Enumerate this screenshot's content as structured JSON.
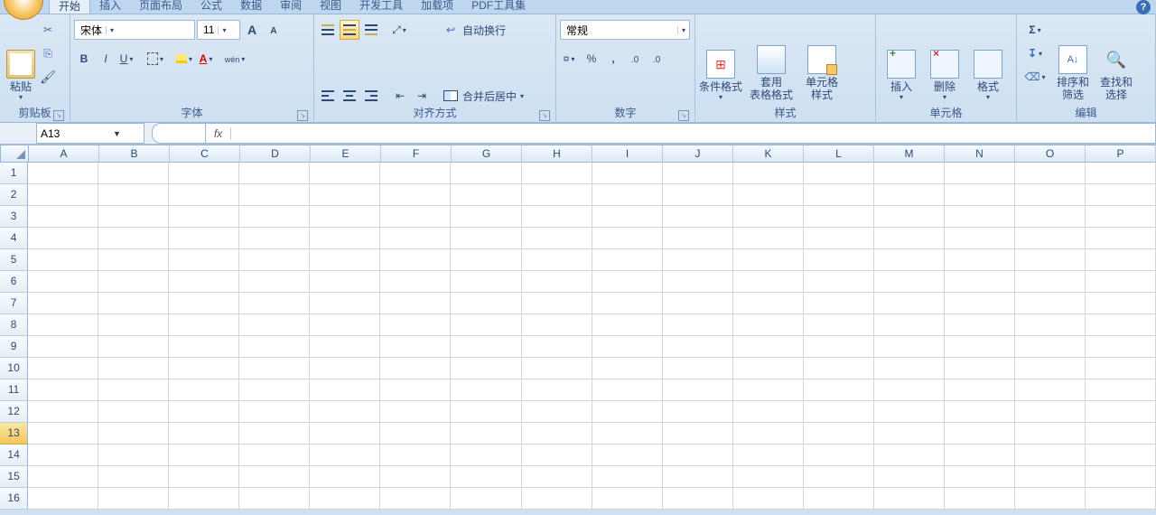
{
  "tabs": [
    "开始",
    "插入",
    "页面布局",
    "公式",
    "数据",
    "审阅",
    "视图",
    "开发工具",
    "加载项",
    "PDF工具集"
  ],
  "active_tab": 0,
  "clipboard": {
    "paste": "粘贴",
    "group": "剪贴板"
  },
  "font": {
    "name": "宋体",
    "size": "11",
    "group": "字体"
  },
  "align": {
    "wrap": "自动换行",
    "merge": "合并后居中",
    "group": "对齐方式"
  },
  "number": {
    "format": "常规",
    "group": "数字"
  },
  "styles": {
    "cond": "条件格式",
    "table": "套用\n表格格式",
    "cell": "单元格\n样式",
    "group": "样式"
  },
  "cells": {
    "insert": "插入",
    "delete": "删除",
    "format": "格式",
    "group": "单元格"
  },
  "editing": {
    "sort": "排序和\n筛选",
    "find": "查找和\n选择",
    "group": "编辑"
  },
  "namebox": "A13",
  "formula": "",
  "columns": [
    "A",
    "B",
    "C",
    "D",
    "E",
    "F",
    "G",
    "H",
    "I",
    "J",
    "K",
    "L",
    "M",
    "N",
    "O",
    "P"
  ],
  "rows": [
    1,
    2,
    3,
    4,
    5,
    6,
    7,
    8,
    9,
    10,
    11,
    12,
    13,
    14,
    15,
    16
  ],
  "selected_row": 13
}
